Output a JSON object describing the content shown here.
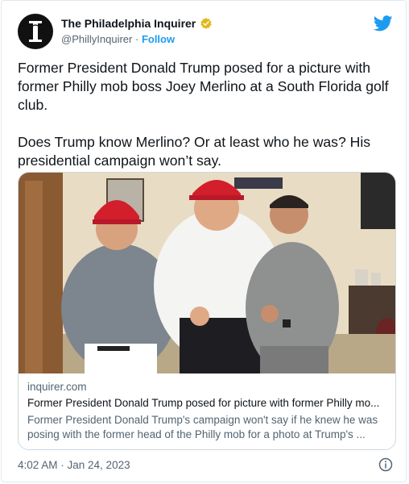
{
  "account": {
    "name": "The Philadelphia Inquirer",
    "handle": "@PhillyInquirer",
    "separator": "·",
    "follow_label": "Follow",
    "logo_glyph": "I",
    "verified_color": "#e2b719"
  },
  "tweet": {
    "paragraphs": [
      "Former President Donald Trump posed for a picture with former Philly mob boss Joey Merlino at a South Florida golf club.",
      "Does Trump know Merlino? Or at least who he was? His presidential campaign won’t say."
    ],
    "timestamp": "4:02 AM · Jan 24, 2023"
  },
  "card": {
    "domain": "inquirer.com",
    "title": "Former President Donald Trump posed for picture with former Philly mo...",
    "description": "Former President Donald Trump's campaign won't say if he knew he was posing with the former head of the Philly mob for a photo at Trump's ..."
  },
  "colors": {
    "twitter_blue": "#1d9bf0",
    "text_primary": "#0f1419",
    "text_secondary": "#536471",
    "border": "#cfd9de"
  },
  "icons": {
    "bird": "twitter-bird-icon",
    "verified": "verified-badge-icon",
    "info": "info-icon"
  }
}
